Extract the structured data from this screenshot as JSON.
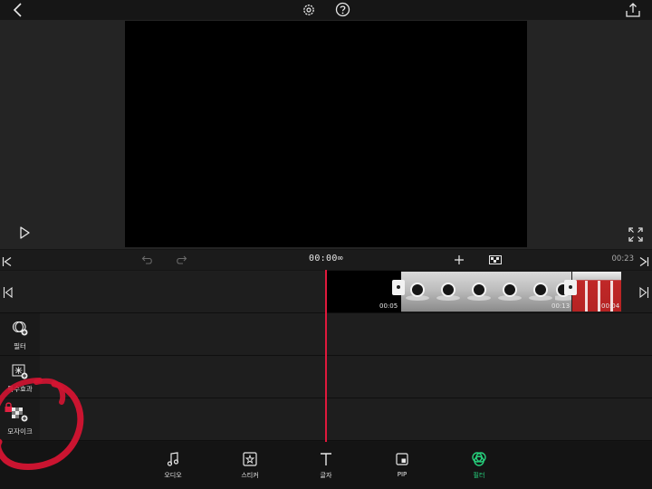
{
  "toolbar": {
    "back_icon": "chevron-left-icon",
    "settings_icon": "gear-icon",
    "help_icon": "question-circle-icon",
    "share_icon": "share-upload-icon"
  },
  "playback": {
    "play_icon": "play-icon",
    "fullscreen_icon": "fullscreen-icon",
    "timecode": "00:00∞",
    "duration": "00:23"
  },
  "timeline": {
    "clips": [
      {
        "label": "00:05"
      },
      {
        "label": "00:13"
      },
      {
        "label": "00:04"
      }
    ]
  },
  "tracks": [
    {
      "label": "필터",
      "icon": "filter-add-icon"
    },
    {
      "label": "특수효과",
      "icon": "effect-add-icon"
    },
    {
      "label": "모자이크",
      "icon": "mosaic-add-icon"
    }
  ],
  "tools": [
    {
      "label": "오디오",
      "icon": "music-note-icon",
      "active": false
    },
    {
      "label": "스티커",
      "icon": "sticker-icon",
      "active": false
    },
    {
      "label": "글자",
      "icon": "text-icon",
      "active": false
    },
    {
      "label": "PIP",
      "icon": "pip-icon",
      "active": false
    },
    {
      "label": "필터",
      "icon": "filter-icon",
      "active": true
    }
  ],
  "colors": {
    "accent": "#26d07c",
    "playhead": "#e0193c",
    "annotation": "#d41432",
    "lock": "#e02040"
  }
}
